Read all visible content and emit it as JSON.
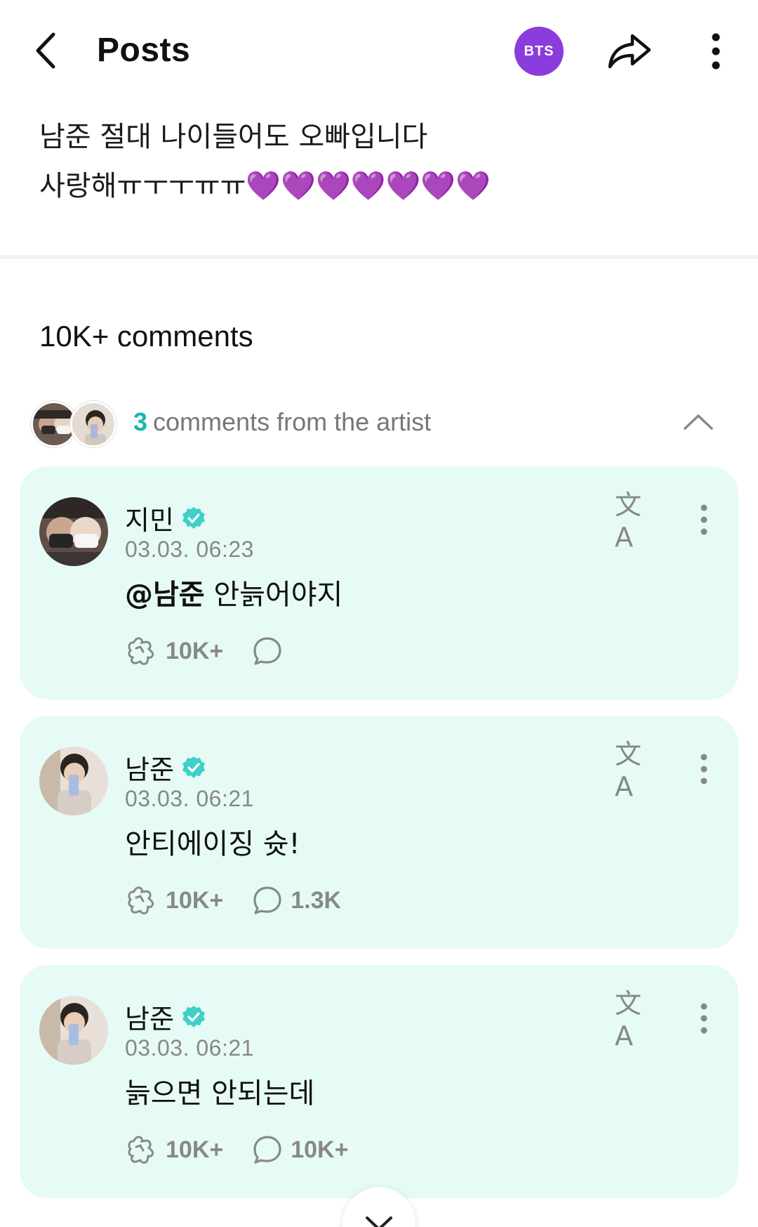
{
  "header": {
    "title": "Posts",
    "artist_badge": "BTS",
    "badge_color": "#8a3cdc"
  },
  "post": {
    "line1": "남준 절대 나이들어도 오빠입니다",
    "line2": "사랑해ㅠㅜㅜㅠㅠ💜💜💜💜💜💜💜"
  },
  "comments": {
    "count_label": "10K+ comments",
    "artist_count": "3",
    "artist_label": "comments from the artist",
    "accent_color": "#18b7ad",
    "card_bg": "#e6fbf6"
  },
  "cards": [
    {
      "author": "지민",
      "time": "03.03. 06:23",
      "mention": "@남준",
      "text": " 안늙어야지",
      "likes": "10K+",
      "replies": ""
    },
    {
      "author": "남준",
      "time": "03.03. 06:21",
      "mention": "",
      "text": "안티에이징 슛!",
      "likes": "10K+",
      "replies": "1.3K"
    },
    {
      "author": "남준",
      "time": "03.03. 06:21",
      "mention": "",
      "text": "늙으면 안되는데",
      "likes": "10K+",
      "replies": "10K+"
    }
  ],
  "icons": {
    "back": "chevron-left-icon",
    "share": "share-arrow-icon",
    "more": "kebab-menu-icon",
    "translate": "translate-icon",
    "verified": "verified-badge-icon",
    "like": "like-cheer-icon",
    "reply": "comment-bubble-icon",
    "collapse": "chevron-up-icon",
    "scroll_down": "chevron-down-icon"
  },
  "translate_glyph": "文A"
}
